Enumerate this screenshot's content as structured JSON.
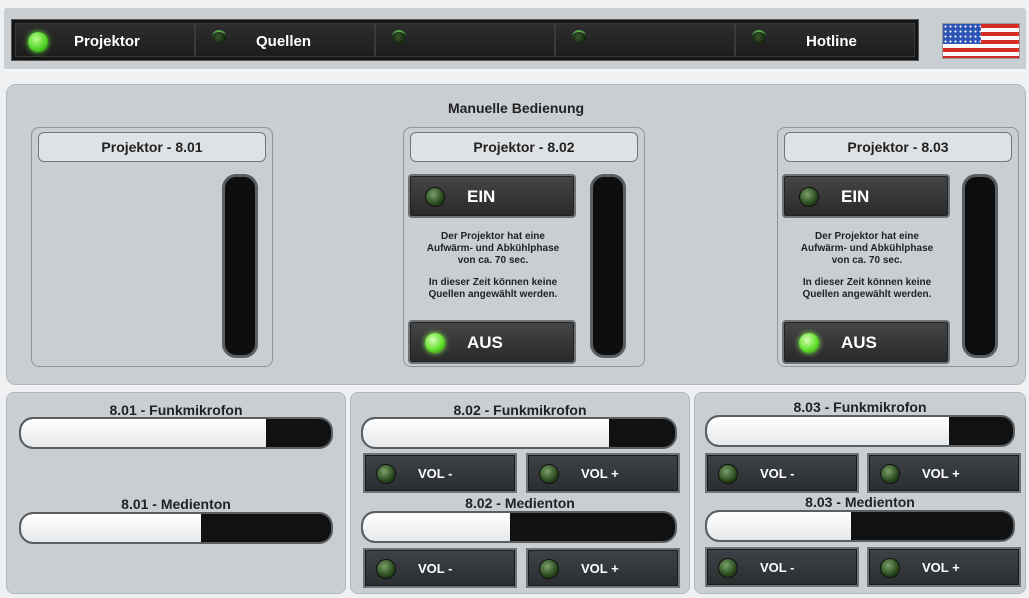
{
  "nav": {
    "tabs": [
      {
        "label": "Projektor",
        "active": true
      },
      {
        "label": "Quellen",
        "active": false
      },
      {
        "label": "",
        "active": false
      },
      {
        "label": "",
        "active": false
      },
      {
        "label": "Hotline",
        "active": false
      }
    ],
    "language_icon": "us-flag-icon"
  },
  "manual": {
    "title": "Manuelle Bedienung",
    "projectors": [
      {
        "title": "Projektor - 8.01",
        "has_controls": false
      },
      {
        "title": "Projektor - 8.02",
        "has_controls": true,
        "on_label": "EIN",
        "off_label": "AUS",
        "info_line1": "Der Projektor hat eine",
        "info_line2": "Aufwärm- und Abkühlphase",
        "info_line3": "von ca. 70 sec.",
        "info_line4": "In dieser Zeit können keine",
        "info_line5": "Quellen angewählt werden.",
        "on_active": false,
        "off_active": true
      },
      {
        "title": "Projektor - 8.03",
        "has_controls": true,
        "on_label": "EIN",
        "off_label": "AUS",
        "info_line1": "Der Projektor hat eine",
        "info_line2": "Aufwärm- und Abkühlphase",
        "info_line3": "von ca. 70 sec.",
        "info_line4": "In dieser Zeit können keine",
        "info_line5": "Quellen angewählt werden.",
        "on_active": false,
        "off_active": true
      }
    ]
  },
  "audio": {
    "rooms": [
      {
        "mic_label": "8.01 - Funkmikrofon",
        "mic_level": 0.79,
        "media_label": "8.01 - Medienton",
        "media_level": 0.58
      },
      {
        "mic_label": "8.02 - Funkmikrofon",
        "mic_level": 0.79,
        "media_label": "8.02 - Medienton",
        "media_level": 0.47,
        "vol_down": "VOL -",
        "vol_up": "VOL +"
      },
      {
        "mic_label": "8.03 - Funkmikrofon",
        "mic_level": 0.79,
        "media_label": "8.03 - Medienton",
        "media_level": 0.47,
        "vol_down": "VOL -",
        "vol_up": "VOL +"
      }
    ]
  },
  "colors": {
    "led_on": "#62e02c",
    "led_off": "#2a4a1e",
    "panel": "#c9ced3",
    "button": "#2b2e31"
  }
}
